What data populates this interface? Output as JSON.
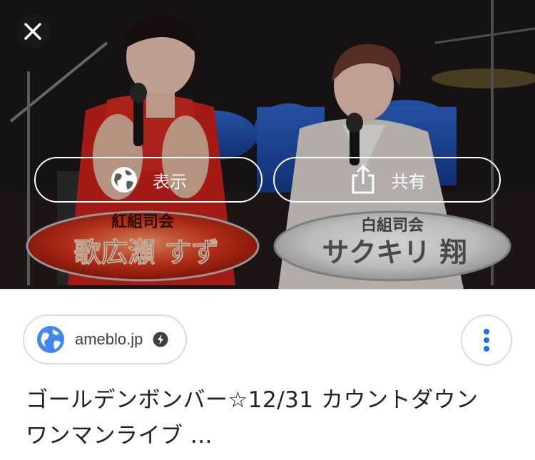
{
  "viewer": {
    "caption_left_role": "紅組司会",
    "caption_left_name": "歌広瀬 すず",
    "caption_right_role": "白組司会",
    "caption_right_name": "サクキリ 翔"
  },
  "actions": {
    "show_label": "表示",
    "share_label": "共有"
  },
  "result": {
    "domain": "ameblo.jp",
    "title": "ゴールデンボンバー☆12/31 カウントダウンワンマンライブ ..."
  },
  "colors": {
    "amp_icon": "#3c4043",
    "globe_icon": "#4285f4",
    "more_dots": "#1a73e8"
  },
  "icons": {
    "close": "close-icon",
    "show": "globe-icon",
    "share": "share-icon",
    "site": "site-globe-icon",
    "amp": "amp-bolt-icon",
    "more": "more-vert-icon"
  }
}
